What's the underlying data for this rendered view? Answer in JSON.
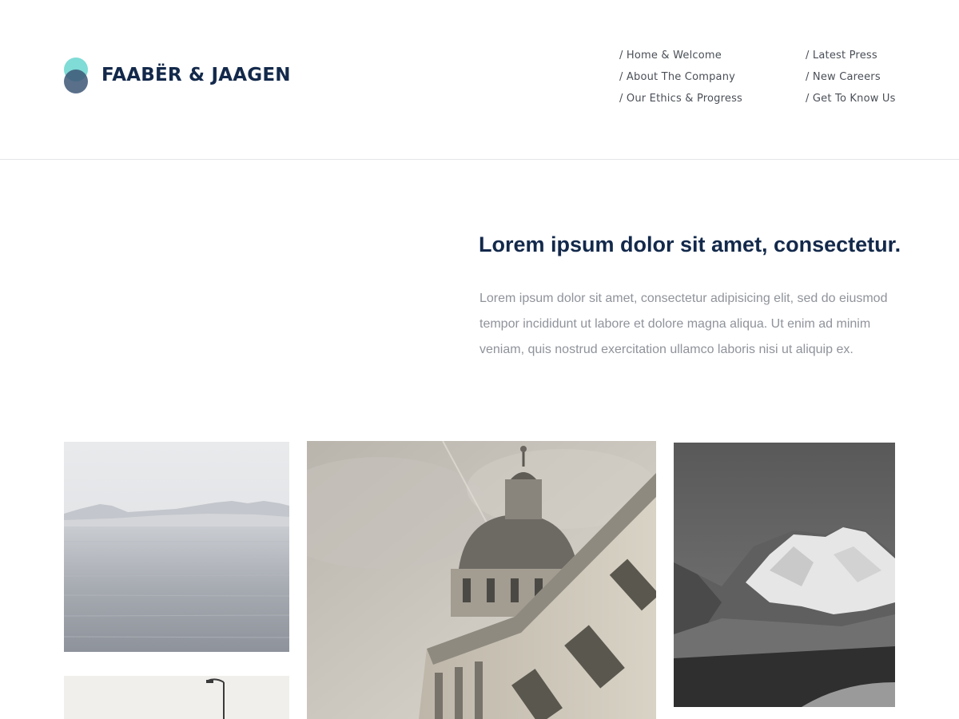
{
  "brand": {
    "name": "FAABËR & JAAGEN",
    "colors": {
      "teal": "#7fdcd6",
      "navy": "#13294b",
      "slate": "#3d5675"
    }
  },
  "nav": {
    "left": [
      {
        "label": "/ Home & Welcome"
      },
      {
        "label": "/ About The Company"
      },
      {
        "label": "/ Our Ethics & Progress"
      }
    ],
    "right": [
      {
        "label": "/ Latest Press"
      },
      {
        "label": "/ New Careers"
      },
      {
        "label": "/ Get To Know Us"
      }
    ]
  },
  "intro": {
    "title": "Lorem ipsum dolor sit amet, consectetur.",
    "body": "Lorem ipsum dolor sit amet, consectetur adipisicing elit, sed do eiusmod tempor incididunt ut labore et dolore magna aliqua. Ut enim ad minim veniam, quis nostrud exercitation ullamco laboris nisi ut aliquip ex."
  },
  "gallery": {
    "photos": [
      "sea-photo",
      "streetlamp-photo",
      "domed-building-photo",
      "snowy-mountain-photo"
    ]
  }
}
